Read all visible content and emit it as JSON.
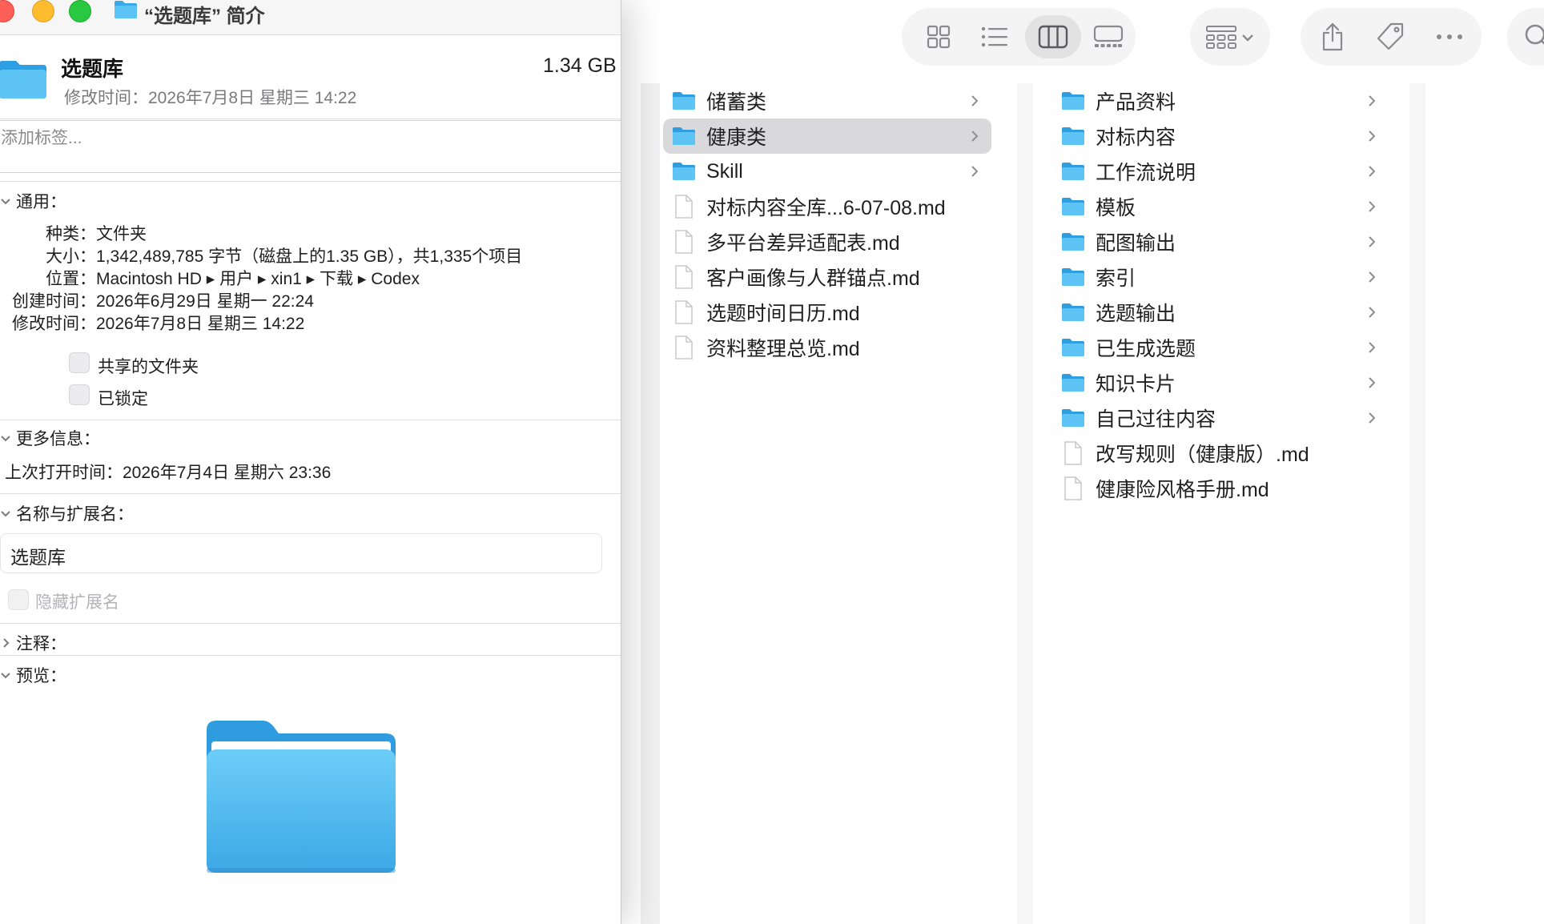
{
  "finder": {
    "toolbar": {
      "view_icons": [
        "icon-view-icon",
        "list-view-icon",
        "column-view-icon",
        "gallery-view-icon"
      ],
      "group_icon": "group-by-icon",
      "actions": [
        "share-icon",
        "tag-icon",
        "more-icon"
      ],
      "search_icon": "search-icon"
    },
    "column1": [
      {
        "label": "储蓄类",
        "type": "folder"
      },
      {
        "label": "健康类",
        "type": "folder",
        "selected": true
      },
      {
        "label": "Skill",
        "type": "folder"
      },
      {
        "label": "对标内容全库...6-07-08.md",
        "type": "file"
      },
      {
        "label": "多平台差异适配表.md",
        "type": "file"
      },
      {
        "label": "客户画像与人群锚点.md",
        "type": "file"
      },
      {
        "label": "选题时间日历.md",
        "type": "file"
      },
      {
        "label": "资料整理总览.md",
        "type": "file"
      }
    ],
    "column2": [
      {
        "label": "产品资料",
        "type": "folder"
      },
      {
        "label": "对标内容",
        "type": "folder"
      },
      {
        "label": "工作流说明",
        "type": "folder"
      },
      {
        "label": "模板",
        "type": "folder"
      },
      {
        "label": "配图输出",
        "type": "folder"
      },
      {
        "label": "索引",
        "type": "folder"
      },
      {
        "label": "选题输出",
        "type": "folder"
      },
      {
        "label": "已生成选题",
        "type": "folder"
      },
      {
        "label": "知识卡片",
        "type": "folder"
      },
      {
        "label": "自己过往内容",
        "type": "folder"
      },
      {
        "label": "改写规则（健康版）.md",
        "type": "file"
      },
      {
        "label": "健康险风格手册.md",
        "type": "file"
      }
    ]
  },
  "info": {
    "window_title": "“选题库” 简介",
    "name": "选题库",
    "size": "1.34 GB",
    "modified_line": "修改时间：2026年7月8日 星期三 14:22",
    "tags_placeholder": "添加标签...",
    "general": {
      "header": "通用：",
      "kind_key": "种类：",
      "kind": "文件夹",
      "size_key": "大小：",
      "size": "1,342,489,785 字节（磁盘上的1.35 GB），共1,335个项目",
      "where_key": "位置：",
      "where": "Macintosh HD ▸ 用户 ▸ xin1 ▸ 下载 ▸ Codex",
      "created_key": "创建时间：",
      "created": "2026年6月29日 星期一 22:24",
      "modified_key": "修改时间：",
      "modified": "2026年7月8日 星期三 14:22",
      "shared_label": "共享的文件夹",
      "locked_label": "已锁定"
    },
    "more_info": {
      "header": "更多信息：",
      "last_opened": "上次打开时间：2026年7月4日 星期六 23:36"
    },
    "name_ext": {
      "header": "名称与扩展名：",
      "value": "选题库",
      "hide_ext_label": "隐藏扩展名"
    },
    "comments": {
      "header": "注释："
    },
    "preview": {
      "header": "预览："
    },
    "folder_icon": "folder-icon"
  }
}
